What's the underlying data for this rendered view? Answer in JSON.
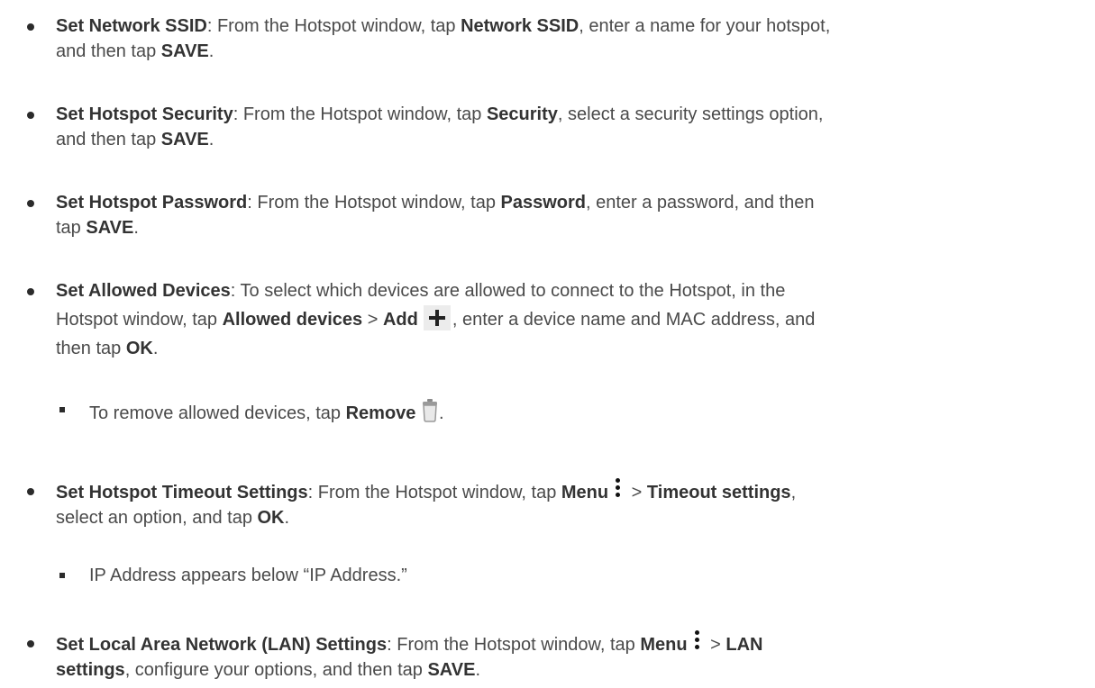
{
  "items": [
    {
      "title": "Set Network SSID",
      "p1": ": From the Hotspot window, tap ",
      "k1": "Network SSID",
      "p2": ", enter a name for your hotspot,",
      "p3": "and then tap ",
      "k2": "SAVE",
      "p4": "."
    },
    {
      "title": "Set Hotspot Security",
      "p1": ": From the Hotspot window, tap ",
      "k1": "Security",
      "p2": ", select a security settings option,",
      "p3": "and then tap ",
      "k2": "SAVE",
      "p4": "."
    },
    {
      "title": "Set Hotspot Password",
      "p1": ": From the Hotspot window, tap ",
      "k1": "Password",
      "p2": ", enter a password, and then",
      "p3": "tap ",
      "k2": "SAVE",
      "p4": "."
    },
    {
      "title": "Set Allowed Devices",
      "p1": ": To select which devices are allowed to connect to the Hotspot, in the",
      "p2": "Hotspot window, tap ",
      "k1": "Allowed devices",
      "p3": " > ",
      "k2": "Add",
      "p4": ", enter a device name and MAC address, and",
      "p5": "then tap ",
      "k3": "OK",
      "p6": "."
    },
    {
      "title": "Set Hotspot Timeout Settings",
      "p1": ": From the Hotspot window, tap ",
      "k1": "Menu",
      "p2": " > ",
      "k2": "Timeout settings",
      "p3": ",",
      "p4": "select an option, and tap ",
      "k3": "OK",
      "p5": "."
    },
    {
      "title": "Set Local Area Network (LAN) Settings",
      "p1": ": From the Hotspot window, tap ",
      "k1": "Menu",
      "p2": " > ",
      "k2": "LAN",
      "k3": "settings",
      "p3": ", configure your options, and then tap ",
      "k4": "SAVE",
      "p4": "."
    }
  ],
  "subitems": [
    {
      "p1": "To remove allowed devices, tap ",
      "k1": "Remove",
      "p2": "."
    },
    {
      "p1": "IP Address appears below “IP Address.”"
    }
  ],
  "icons": {
    "add": "plus-icon",
    "remove": "trash-icon",
    "menu": "more-vertical-icon"
  }
}
